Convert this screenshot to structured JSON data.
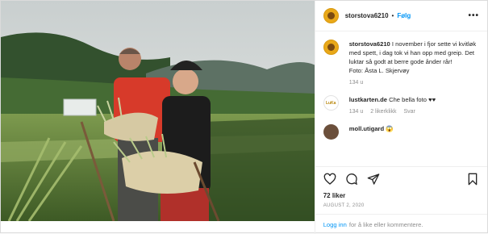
{
  "header": {
    "username": "storstova6210",
    "separator": "•",
    "follow_label": "Følg",
    "more_label": "•••"
  },
  "caption": {
    "username": "storstova6210",
    "text": "I november i fjor sette vi kvitløk med spett, i dag tok vi han opp med greip. Det luktar så godt at berre gode ånder rår!",
    "credit": "Foto: Åsta L. Skjervøy",
    "age": "134 u"
  },
  "comments": [
    {
      "username": "lustkarten.de",
      "text": "Che bella foto ♥♥",
      "age": "134 u",
      "likes": "2 likerklikk",
      "reply_label": "Svar",
      "avatar_text": "LuKa"
    },
    {
      "username": "moll.utigard",
      "text": "😱",
      "age": "",
      "likes": "",
      "reply_label": ""
    }
  ],
  "actions": {
    "icons": [
      "heart-icon",
      "comment-icon",
      "share-icon",
      "bookmark-icon"
    ]
  },
  "likes_count": "72 liker",
  "post_date": "AUGUST 2, 2020",
  "login_bar": {
    "link_label": "Logg inn",
    "text": "for å like eller kommentere."
  },
  "colors": {
    "accent": "#0095f6",
    "muted": "#8e8e8e",
    "text": "#262626",
    "avatar": "#e9a818"
  }
}
